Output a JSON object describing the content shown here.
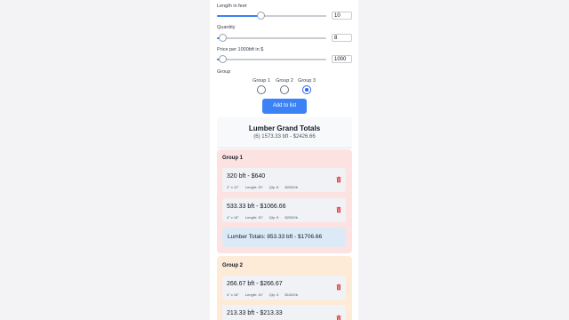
{
  "form": {
    "length": {
      "label": "Length in feet",
      "value": "10",
      "fraction": 0.4
    },
    "quantity": {
      "label": "Quantity",
      "value": "8",
      "fraction": 0.05
    },
    "price": {
      "label": "Price per 1000bft in $",
      "value": "1000",
      "fraction": 0.05
    },
    "group_label": "Group",
    "groups": [
      {
        "label": "Group 1",
        "selected": false
      },
      {
        "label": "Group 2",
        "selected": false
      },
      {
        "label": "Group 3",
        "selected": true
      }
    ],
    "add_button": "Add to list"
  },
  "grand_totals": {
    "title": "Lumber Grand Totals",
    "summary": "(6) 1573.33 bft - $2426.66"
  },
  "groups": [
    {
      "title": "Group 1",
      "color": "#fde2e2",
      "items": [
        {
          "main": "320 bft - $640",
          "dims": "2\" x 12\"",
          "length": "Length: 20'",
          "qty": "Qty: 8",
          "price": "$2000/b"
        },
        {
          "main": "533.33 bft - $1066.66",
          "dims": "4\" x 16\"",
          "length": "Length: 20'",
          "qty": "Qty: 5",
          "price": "$2000/b"
        }
      ],
      "total": "Lumber Totals: 853.33 bft - $1706.66"
    },
    {
      "title": "Group 2",
      "color": "#fdebd8",
      "items": [
        {
          "main": "266.67 bft - $266.67",
          "dims": "4\" x 16\"",
          "length": "Length: 10'",
          "qty": "Qty: 5",
          "price": "$1000/b"
        },
        {
          "main": "213.33 bft - $213.33"
        }
      ]
    }
  ],
  "icons": {
    "delete": "trash-icon",
    "accent": "#3b82f6",
    "delete_color": "#dc2626"
  }
}
